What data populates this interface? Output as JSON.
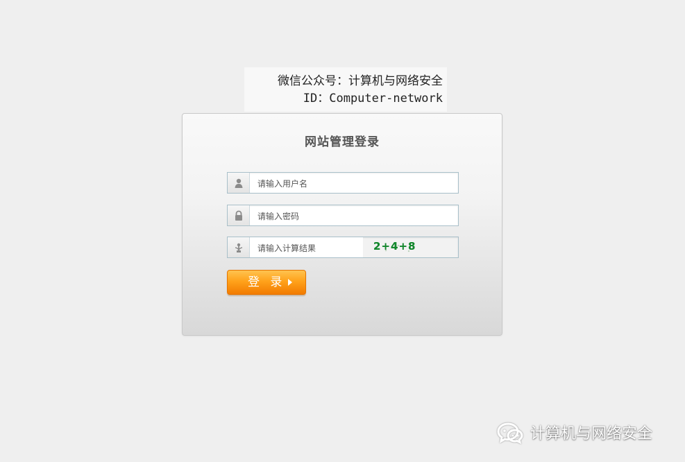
{
  "overlay_text": {
    "line1": "微信公众号：计算机与网络安全",
    "line2": "ID：Computer-network"
  },
  "login": {
    "title": "网站管理登录",
    "username_placeholder": "请输入用户名",
    "password_placeholder": "请输入密码",
    "captcha_placeholder": "请输入计算结果",
    "captcha_challenge": "2+4+8",
    "submit_label": "登 录"
  },
  "watermark": {
    "label": "计算机与网络安全"
  },
  "icons": {
    "username": "user-icon",
    "password": "lock-icon",
    "captcha": "captcha-icon",
    "submit": "triangle-right-icon",
    "brand": "wechat-icon"
  },
  "colors": {
    "button_orange": "#ffa21b",
    "field_border": "#a8bfc9",
    "captcha_green": "#13892d"
  }
}
